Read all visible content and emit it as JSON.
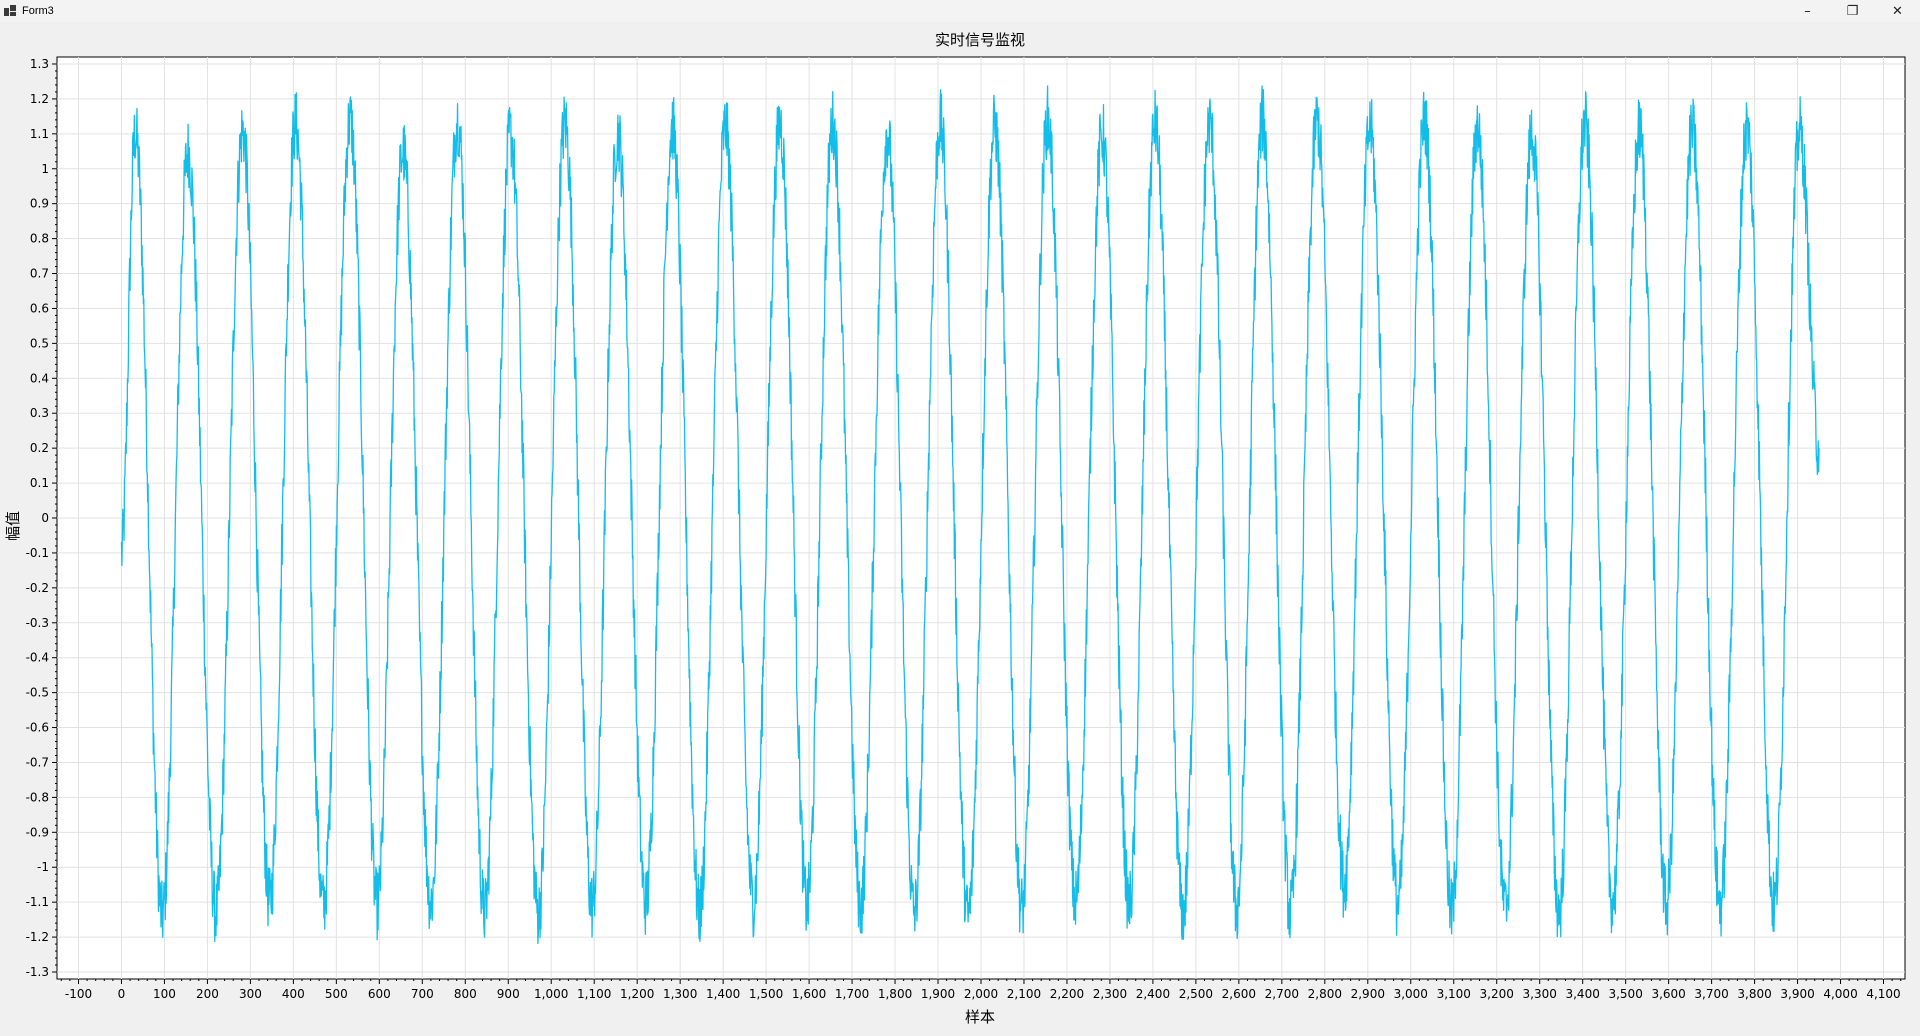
{
  "window": {
    "title": "Form3",
    "icon": "app-window-icon",
    "controls": {
      "minimize": "–",
      "maximize": "❐",
      "close": "✕"
    }
  },
  "chart_data": {
    "type": "line",
    "title": "实时信号监视",
    "xlabel": "样本",
    "ylabel": "幅值",
    "xlim": [
      -150,
      4150
    ],
    "ylim": [
      -1.32,
      1.32
    ],
    "x_ticks": [
      -100,
      0,
      100,
      200,
      300,
      400,
      500,
      600,
      700,
      800,
      900,
      1000,
      1100,
      1200,
      1300,
      1400,
      1500,
      1600,
      1700,
      1800,
      1900,
      2000,
      2100,
      2200,
      2300,
      2400,
      2500,
      2600,
      2700,
      2800,
      2900,
      3000,
      3100,
      3200,
      3300,
      3400,
      3500,
      3600,
      3700,
      3800,
      3900,
      4000,
      4100
    ],
    "x_tick_labels": [
      "-100",
      "0",
      "100",
      "200",
      "300",
      "400",
      "500",
      "600",
      "700",
      "800",
      "900",
      "1,000",
      "1,100",
      "1,200",
      "1,300",
      "1,400",
      "1,500",
      "1,600",
      "1,700",
      "1,800",
      "1,900",
      "2,000",
      "2,100",
      "2,200",
      "2,300",
      "2,400",
      "2,500",
      "2,600",
      "2,700",
      "2,800",
      "2,900",
      "3,000",
      "3,100",
      "3,200",
      "3,300",
      "3,400",
      "3,500",
      "3,600",
      "3,700",
      "3,800",
      "3,900",
      "4,000",
      "4,100"
    ],
    "y_ticks": [
      1.3,
      1.2,
      1.1,
      1,
      0.9,
      0.8,
      0.7,
      0.6,
      0.5,
      0.4,
      0.3,
      0.2,
      0.1,
      0,
      -0.1,
      -0.2,
      -0.3,
      -0.4,
      -0.5,
      -0.6,
      -0.7,
      -0.8,
      -0.9,
      -1,
      -1.1,
      -1.2,
      -1.3
    ],
    "y_tick_labels": [
      "1.3",
      "1.2",
      "1.1",
      "1",
      "0.9",
      "0.8",
      "0.7",
      "0.6",
      "0.5",
      "0.4",
      "0.3",
      "0.2",
      "0.1",
      "0",
      "-0.1",
      "-0.2",
      "-0.3",
      "-0.4",
      "-0.5",
      "-0.6",
      "-0.7",
      "-0.8",
      "-0.9",
      "-1",
      "-1.1",
      "-1.2",
      "-1.3"
    ],
    "grid": true,
    "legend": "none",
    "series": [
      {
        "color": "#12bde9",
        "x_start": 0,
        "x_end": 3950,
        "period": 125,
        "amplitude": 1.0,
        "noise": 0.1,
        "extrema": [
          {
            "x": 32,
            "y": 1.1
          },
          {
            "x": 95,
            "y": -1.14
          },
          {
            "x": 155,
            "y": 1.05
          },
          {
            "x": 220,
            "y": -1.13
          },
          {
            "x": 282,
            "y": 1.11
          },
          {
            "x": 345,
            "y": -1.1
          },
          {
            "x": 405,
            "y": 1.13
          },
          {
            "x": 470,
            "y": -1.11
          },
          {
            "x": 532,
            "y": 1.14
          },
          {
            "x": 595,
            "y": -1.11
          },
          {
            "x": 655,
            "y": 1.05
          },
          {
            "x": 720,
            "y": -1.1
          },
          {
            "x": 782,
            "y": 1.14
          },
          {
            "x": 845,
            "y": -1.13
          },
          {
            "x": 905,
            "y": 1.1
          },
          {
            "x": 970,
            "y": -1.13
          },
          {
            "x": 1032,
            "y": 1.13
          },
          {
            "x": 1095,
            "y": -1.11
          },
          {
            "x": 1155,
            "y": 1.1
          },
          {
            "x": 1220,
            "y": -1.1
          },
          {
            "x": 1282,
            "y": 1.12
          },
          {
            "x": 1345,
            "y": -1.13
          },
          {
            "x": 1405,
            "y": 1.12
          },
          {
            "x": 1470,
            "y": -1.1
          },
          {
            "x": 1532,
            "y": 1.13
          },
          {
            "x": 1595,
            "y": -1.11
          },
          {
            "x": 1655,
            "y": 1.13
          },
          {
            "x": 1720,
            "y": -1.11
          },
          {
            "x": 1782,
            "y": 1.1
          },
          {
            "x": 1845,
            "y": -1.13
          },
          {
            "x": 1905,
            "y": 1.13
          },
          {
            "x": 1970,
            "y": -1.14
          },
          {
            "x": 2032,
            "y": 1.12
          },
          {
            "x": 2095,
            "y": -1.12
          },
          {
            "x": 2155,
            "y": 1.14
          },
          {
            "x": 2220,
            "y": -1.1
          },
          {
            "x": 2282,
            "y": 1.1
          },
          {
            "x": 2345,
            "y": -1.11
          },
          {
            "x": 2405,
            "y": 1.13
          },
          {
            "x": 2470,
            "y": -1.13
          },
          {
            "x": 2532,
            "y": 1.13
          },
          {
            "x": 2595,
            "y": -1.12
          },
          {
            "x": 2655,
            "y": 1.14
          },
          {
            "x": 2720,
            "y": -1.13
          },
          {
            "x": 2782,
            "y": 1.14
          },
          {
            "x": 2845,
            "y": -1.05
          },
          {
            "x": 2905,
            "y": 1.12
          },
          {
            "x": 2970,
            "y": -1.11
          },
          {
            "x": 3032,
            "y": 1.14
          },
          {
            "x": 3095,
            "y": -1.13
          },
          {
            "x": 3155,
            "y": 1.12
          },
          {
            "x": 3220,
            "y": -1.12
          },
          {
            "x": 3282,
            "y": 1.1
          },
          {
            "x": 3345,
            "y": -1.13
          },
          {
            "x": 3405,
            "y": 1.13
          },
          {
            "x": 3470,
            "y": -1.1
          },
          {
            "x": 3532,
            "y": 1.11
          },
          {
            "x": 3595,
            "y": -1.11
          },
          {
            "x": 3655,
            "y": 1.11
          },
          {
            "x": 3720,
            "y": -1.11
          },
          {
            "x": 3782,
            "y": 1.12
          },
          {
            "x": 3845,
            "y": -1.11
          },
          {
            "x": 3905,
            "y": 1.11
          },
          {
            "x": 3950,
            "y": 0.2
          }
        ]
      }
    ]
  }
}
